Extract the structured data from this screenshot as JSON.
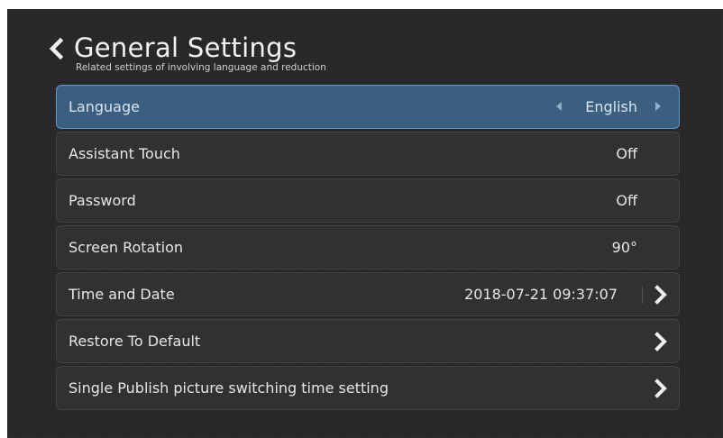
{
  "header": {
    "back_icon": "chevron-left-icon",
    "title": "General Settings",
    "subtitle": "Related settings of involving language and reduction"
  },
  "settings": [
    {
      "label": "Language",
      "value": "English",
      "control": "left-right-selector",
      "selected": true
    },
    {
      "label": "Assistant Touch",
      "value": "Off"
    },
    {
      "label": "Password",
      "value": "Off"
    },
    {
      "label": "Screen Rotation",
      "value": "90°"
    },
    {
      "label": "Time and Date",
      "value": "2018-07-21 09:37:07",
      "chevron_icon": "chevron-right-icon"
    },
    {
      "label": "Restore To Default",
      "chevron_icon": "chevron-right-icon"
    },
    {
      "label": "Single Publish picture switching time setting",
      "chevron_icon": "chevron-right-icon"
    }
  ],
  "colors": {
    "background": "#262626",
    "row": "#313131",
    "selected_row": "#3b5f7e",
    "selected_border": "#5c95c8",
    "text": "#e6e6e6"
  }
}
